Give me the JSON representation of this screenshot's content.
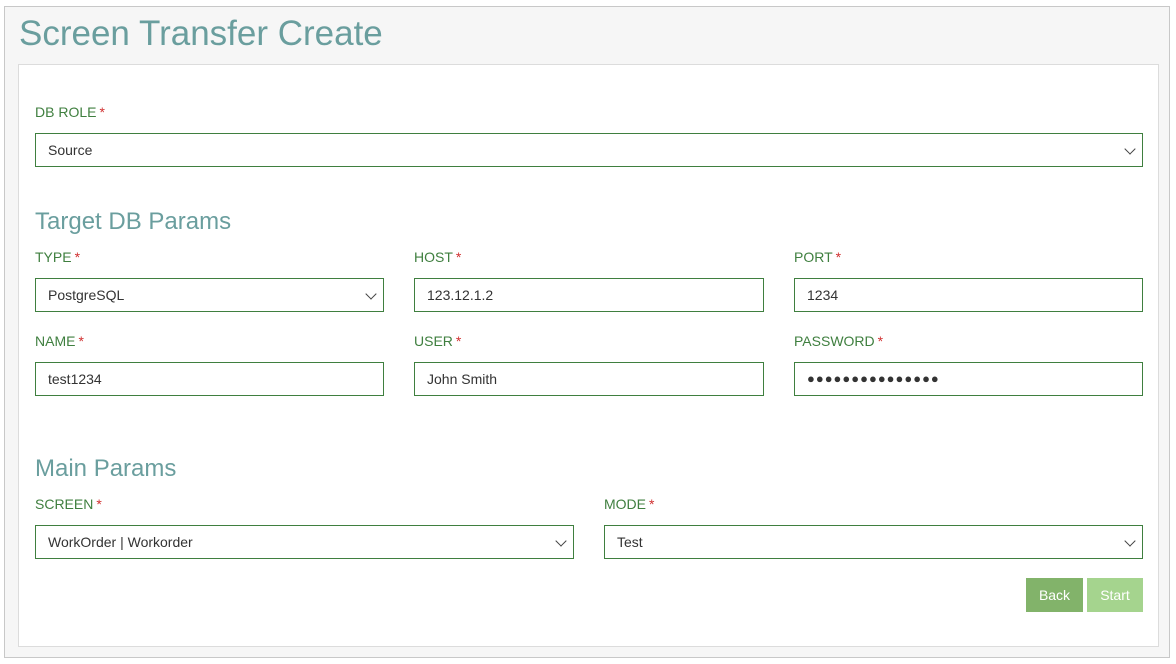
{
  "page": {
    "title": "Screen Transfer Create"
  },
  "db_role": {
    "label": "DB ROLE",
    "required": "*",
    "value": "Source"
  },
  "target_db": {
    "title": "Target DB Params",
    "type": {
      "label": "TYPE",
      "required": "*",
      "value": "PostgreSQL"
    },
    "host": {
      "label": "HOST",
      "required": "*",
      "value": "123.12.1.2"
    },
    "port": {
      "label": "PORT",
      "required": "*",
      "value": "1234"
    },
    "name": {
      "label": "NAME",
      "required": "*",
      "value": "test1234"
    },
    "user": {
      "label": "USER",
      "required": "*",
      "value": "John Smith"
    },
    "password": {
      "label": "PASSWORD",
      "required": "*",
      "value": "●●●●●●●●●●●●●●●"
    }
  },
  "main_params": {
    "title": "Main Params",
    "screen": {
      "label": "SCREEN",
      "required": "*",
      "value": "WorkOrder | Workorder"
    },
    "mode": {
      "label": "MODE",
      "required": "*",
      "value": "Test"
    }
  },
  "actions": {
    "back_label": "Back",
    "start_label": "Start"
  },
  "colors": {
    "label_green": "#3f7f3f",
    "heading_teal": "#6a9e9e",
    "required_red": "#d03030",
    "back_button": "#82b36a",
    "start_button": "#a5d48e"
  }
}
